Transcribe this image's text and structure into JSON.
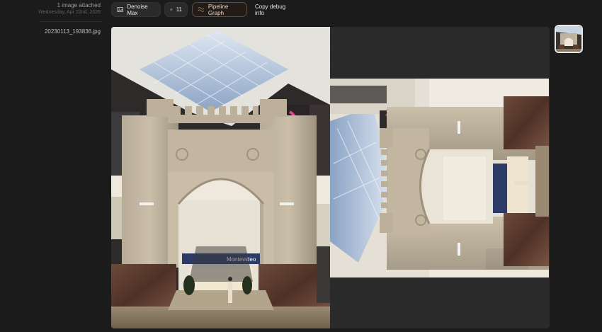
{
  "sidebar": {
    "attachment_count": "1 image attached",
    "attachment_date": "Wednesday, Apr 22nd, 2026",
    "file_name": "20230113_193836.jpg"
  },
  "toolbar": {
    "denoise_label": "Denoise Max",
    "sliders_count": "11",
    "pipeline_label": "Pipeline Graph",
    "copy_label": "Copy debug info"
  },
  "photo": {
    "sign_text": "Montevideo"
  },
  "colors": {
    "background": "#1b1b1c",
    "pipeline_border": "#6a4a34",
    "thumb_border": "#e8e8e8"
  },
  "icons": [
    "denoise-icon",
    "sliders-icon",
    "pipeline-icon"
  ]
}
